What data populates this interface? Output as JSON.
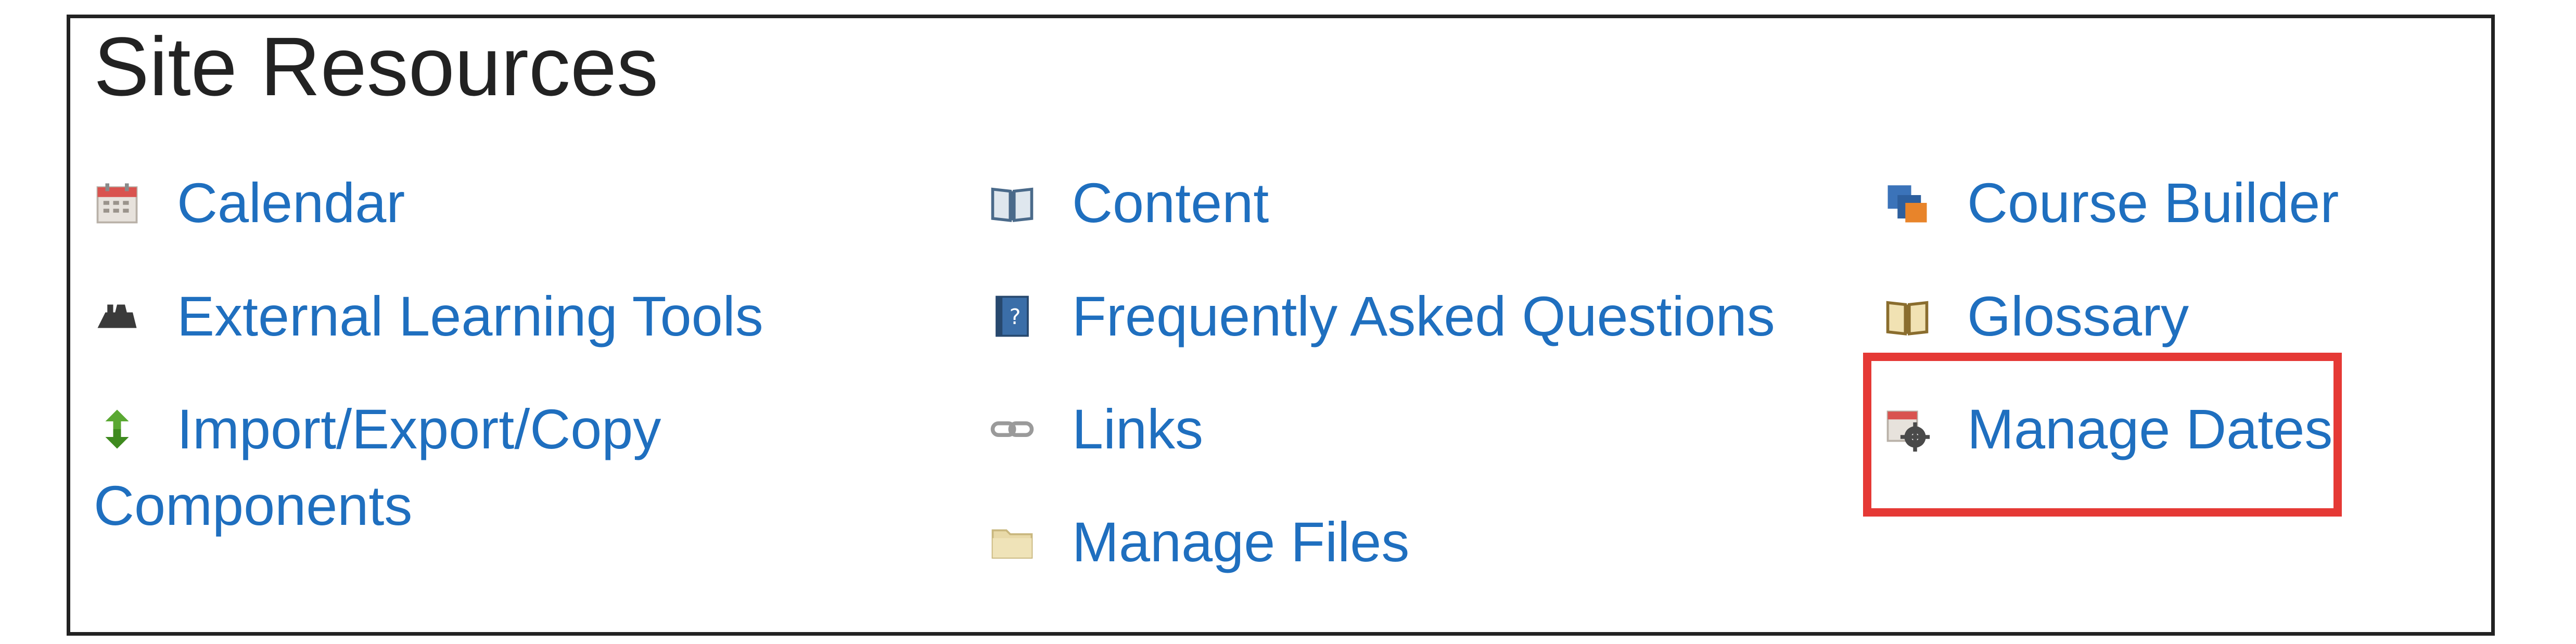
{
  "panel": {
    "title": "Site Resources"
  },
  "columns": [
    {
      "items": [
        {
          "label": "Calendar",
          "icon": "calendar-icon"
        },
        {
          "label": "External Learning Tools",
          "icon": "plug-icon"
        },
        {
          "label": "Import/Export/Copy",
          "label_cont": "Components",
          "icon": "import-export-icon"
        }
      ]
    },
    {
      "items": [
        {
          "label": "Content",
          "icon": "book-icon"
        },
        {
          "label": "Frequently Asked Questions",
          "icon": "faq-icon"
        },
        {
          "label": "Links",
          "icon": "link-icon"
        },
        {
          "label": "Manage Files",
          "icon": "folder-icon"
        }
      ]
    },
    {
      "items": [
        {
          "label": "Course Builder",
          "icon": "course-builder-icon"
        },
        {
          "label": "Glossary",
          "icon": "glossary-icon"
        },
        {
          "label": "Manage Dates",
          "icon": "manage-dates-icon"
        }
      ]
    }
  ],
  "colors": {
    "link": "#1f6fbf",
    "highlight": "#e53935",
    "border": "#222222"
  }
}
